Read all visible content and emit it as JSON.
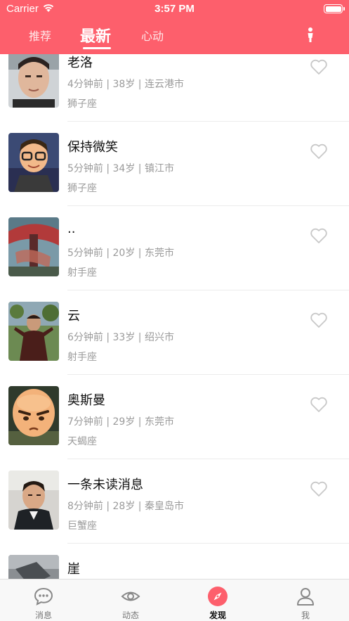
{
  "status_bar": {
    "carrier": "Carrier",
    "time": "3:57 PM"
  },
  "header": {
    "tabs": [
      {
        "label": "推荐"
      },
      {
        "label": "最新"
      },
      {
        "label": "心动"
      }
    ],
    "active_tab": "最新",
    "accent_color": "#fd5f6c"
  },
  "users": [
    {
      "name": "老洛",
      "meta": "4分钟前 | 38岁 | 连云港市",
      "sign": "狮子座"
    },
    {
      "name": "保持微笑",
      "meta": "5分钟前 | 34岁 | 镇江市",
      "sign": "狮子座"
    },
    {
      "name": "..",
      "meta": "5分钟前 | 20岁 | 东莞市",
      "sign": "射手座"
    },
    {
      "name": "云",
      "meta": "6分钟前 | 33岁 | 绍兴市",
      "sign": "射手座"
    },
    {
      "name": "奥斯曼",
      "meta": "7分钟前 | 29岁 | 东莞市",
      "sign": "天蝎座"
    },
    {
      "name": "一条未读消息",
      "meta": "8分钟前 | 28岁 | 秦皇岛市",
      "sign": "巨蟹座"
    },
    {
      "name": "崖"
    }
  ],
  "tabbar": {
    "items": [
      {
        "label": "消息",
        "icon": "chat-icon"
      },
      {
        "label": "动态",
        "icon": "eye-icon"
      },
      {
        "label": "发现",
        "icon": "compass-icon"
      },
      {
        "label": "我",
        "icon": "person-icon"
      }
    ],
    "active": "发现"
  }
}
